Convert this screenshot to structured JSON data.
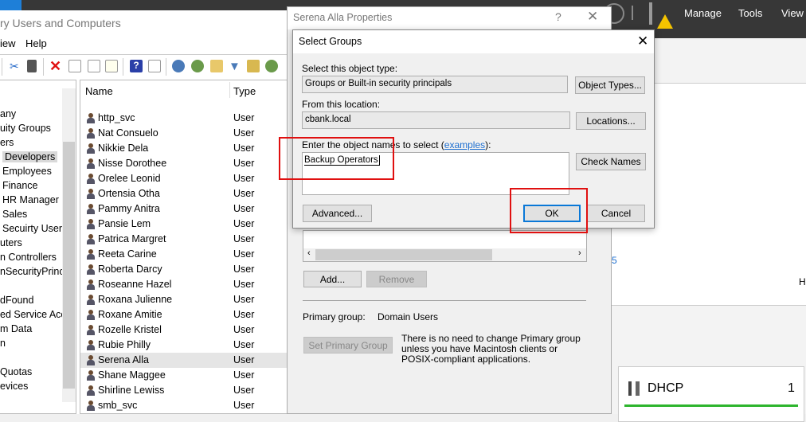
{
  "server_manager": {
    "menu": [
      "Manage",
      "Tools",
      "View"
    ],
    "partial_text": "Hi",
    "partial_link": "5",
    "tile": {
      "label": "DHCP",
      "count": "1"
    },
    "colors": {
      "bar": "#373737",
      "status": "#2db52d",
      "warning": "#f5c400"
    }
  },
  "aduc": {
    "title": "ry Users and Computers",
    "menu": [
      "iew",
      "Help"
    ],
    "tree": [
      "any",
      "uity Groups",
      "ers",
      "Developers",
      "Employees",
      "Finance",
      "HR Manager",
      "Sales",
      "Secuirty Users",
      "uters",
      "n Controllers",
      "nSecurityPrinci",
      "",
      "dFound",
      "ed Service Acc",
      "m Data",
      "n",
      "",
      "Quotas",
      "evices"
    ],
    "selected_tree": "Developers",
    "columns": [
      "Name",
      "Type"
    ],
    "rows": [
      [
        "http_svc",
        "User"
      ],
      [
        "Nat Consuelo",
        "User"
      ],
      [
        "Nikkie Dela",
        "User"
      ],
      [
        "Nisse Dorothee",
        "User"
      ],
      [
        "Orelee Leonid",
        "User"
      ],
      [
        "Ortensia Otha",
        "User"
      ],
      [
        "Pammy Anitra",
        "User"
      ],
      [
        "Pansie Lem",
        "User"
      ],
      [
        "Patrica Margret",
        "User"
      ],
      [
        "Reeta Carine",
        "User"
      ],
      [
        "Roberta Darcy",
        "User"
      ],
      [
        "Roseanne Hazel",
        "User"
      ],
      [
        "Roxana Julienne",
        "User"
      ],
      [
        "Roxane Amitie",
        "User"
      ],
      [
        "Rozelle Kristel",
        "User"
      ],
      [
        "Rubie Philly",
        "User"
      ],
      [
        "Serena Alla",
        "User"
      ],
      [
        "Shane Maggee",
        "User"
      ],
      [
        "Shirline Lewiss",
        "User"
      ],
      [
        "smb_svc",
        "User"
      ]
    ],
    "selected_row": "Serena Alla"
  },
  "properties": {
    "title": "Serena Alla Properties",
    "help": "?",
    "add": "Add...",
    "remove": "Remove",
    "primary_label": "Primary group:",
    "primary_value": "Domain Users",
    "set_primary": "Set Primary Group",
    "note": "There is no need to change Primary group unless you have Macintosh clients or POSIX-compliant applications."
  },
  "select_groups": {
    "title": "Select Groups",
    "type_label": "Select this object type:",
    "type_value": "Groups or Built-in security principals",
    "object_types": "Object Types...",
    "location_label": "From this location:",
    "location_value": "cbank.local",
    "locations": "Locations...",
    "names_label": "Enter the object names to select (",
    "examples": "examples",
    "names_label_end": "):",
    "names_value": "Backup Operators",
    "check_names": "Check Names",
    "advanced": "Advanced...",
    "ok": "OK",
    "cancel": "Cancel"
  }
}
